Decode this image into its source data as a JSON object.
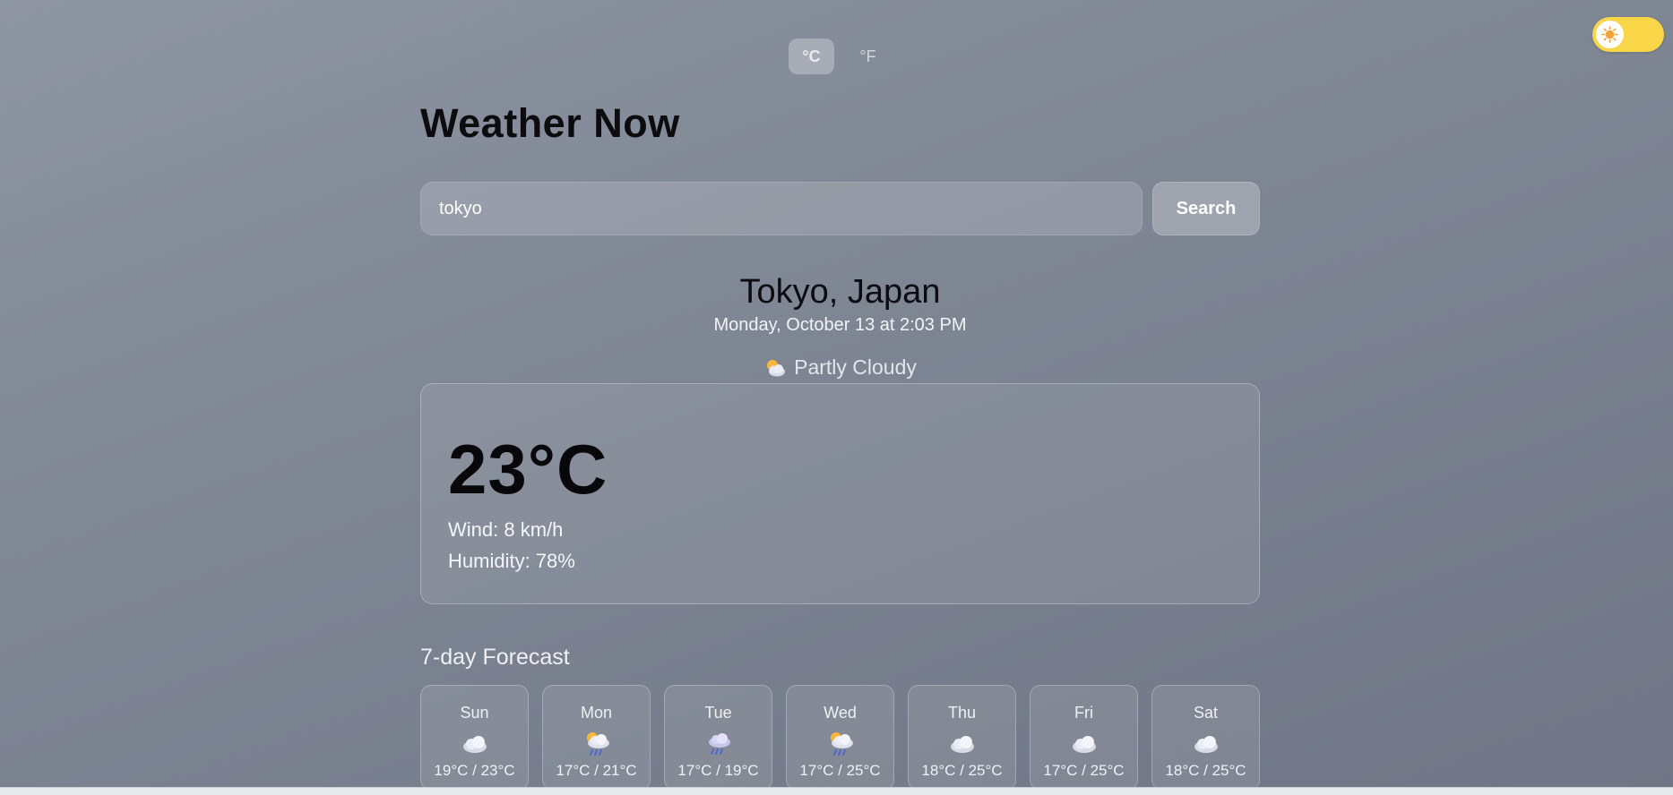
{
  "units": {
    "celsius": "°C",
    "fahrenheit": "°F",
    "selected": "celsius"
  },
  "theme_toggle": {
    "mode": "light",
    "icon": "sun-icon",
    "accent": "#f8d648"
  },
  "app": {
    "title": "Weather Now"
  },
  "search": {
    "value": "tokyo",
    "button_label": "Search"
  },
  "location": {
    "name": "Tokyo, Japan",
    "datetime": "Monday, October 13 at 2:03 PM"
  },
  "current": {
    "condition": "Partly Cloudy",
    "condition_icon": "partly-cloudy-icon",
    "temperature": "23°C",
    "wind": "Wind: 8 km/h",
    "humidity": "Humidity: 78%"
  },
  "forecast": {
    "title": "7-day Forecast",
    "days": [
      {
        "day": "Sun",
        "icon": "cloud-icon",
        "temps": "19°C / 23°C"
      },
      {
        "day": "Mon",
        "icon": "sun-rain-icon",
        "temps": "17°C / 21°C"
      },
      {
        "day": "Tue",
        "icon": "rain-cloud-icon",
        "temps": "17°C / 19°C"
      },
      {
        "day": "Wed",
        "icon": "sun-rain-icon",
        "temps": "17°C / 25°C"
      },
      {
        "day": "Thu",
        "icon": "cloud-icon",
        "temps": "18°C / 25°C"
      },
      {
        "day": "Fri",
        "icon": "cloud-icon",
        "temps": "17°C / 25°C"
      },
      {
        "day": "Sat",
        "icon": "cloud-icon",
        "temps": "18°C / 25°C"
      }
    ]
  }
}
